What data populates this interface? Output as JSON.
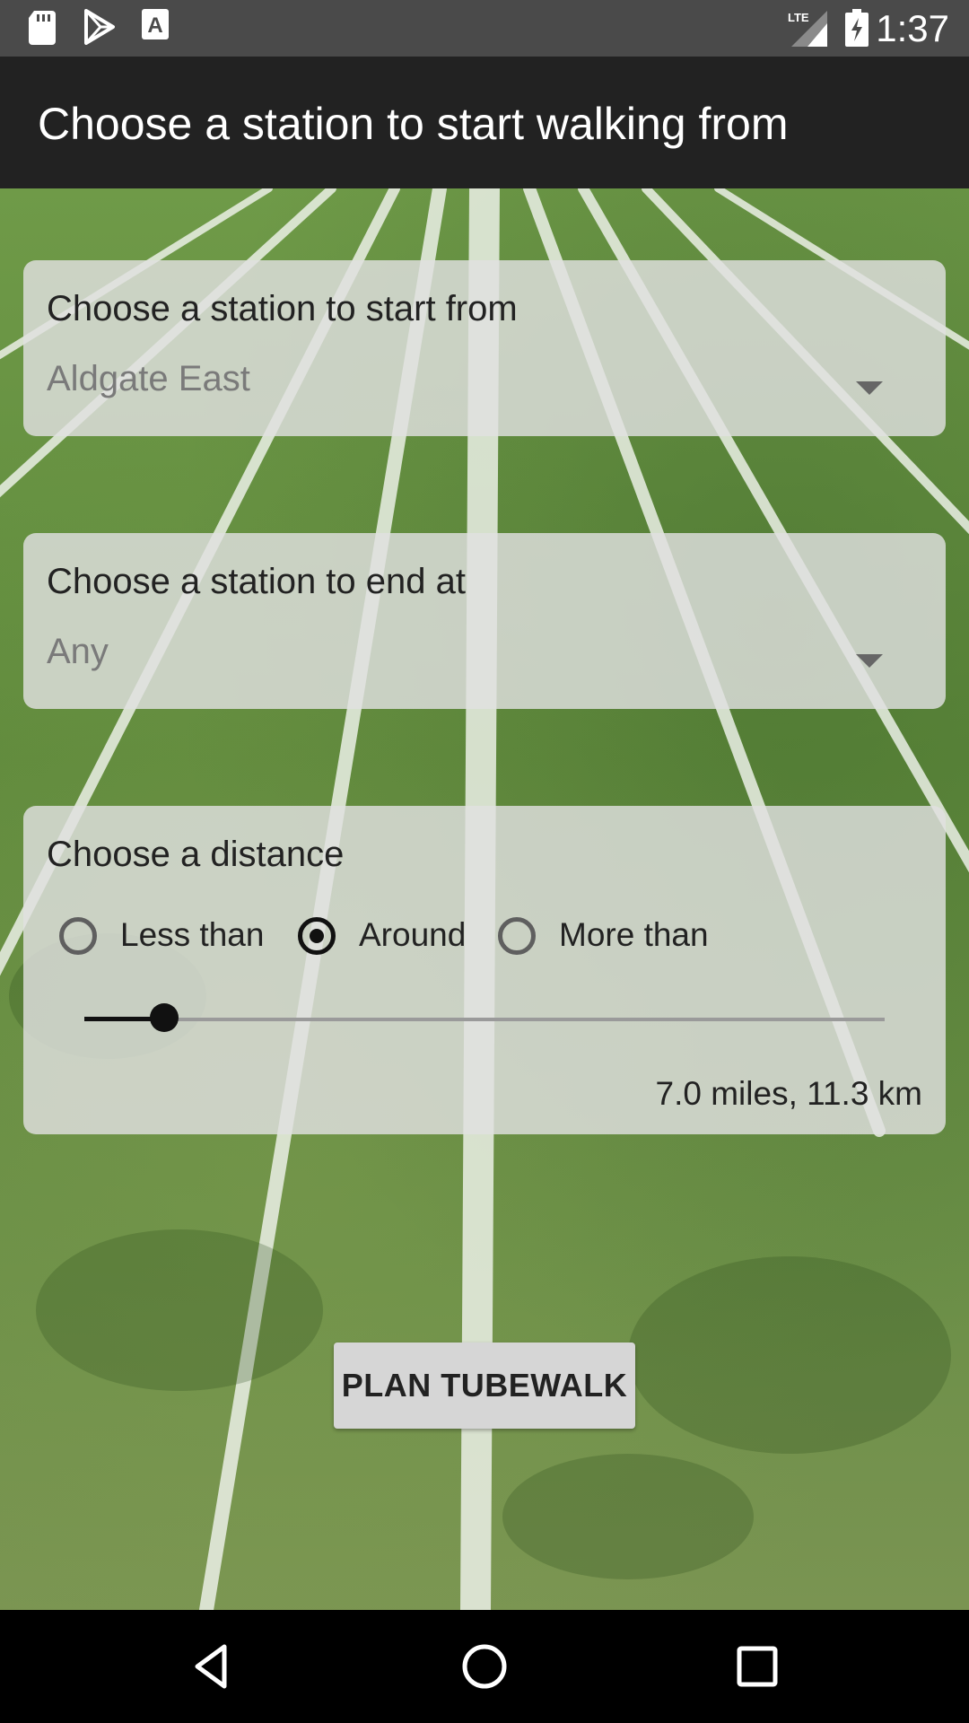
{
  "status_bar": {
    "time": "1:37",
    "network": "LTE",
    "icons": [
      "sd-card-icon",
      "play-store-icon",
      "a-font-icon",
      "signal-icon",
      "battery-charging-icon"
    ]
  },
  "app_bar": {
    "title": "Choose a station to start walking from"
  },
  "start_station": {
    "label": "Choose a station to start from",
    "value": "Aldgate East"
  },
  "end_station": {
    "label": "Choose a station to end at",
    "value": "Any"
  },
  "distance": {
    "label": "Choose a distance",
    "options": [
      {
        "label": "Less than",
        "checked": false
      },
      {
        "label": "Around",
        "checked": true
      },
      {
        "label": "More than",
        "checked": false
      }
    ],
    "slider_fraction": 0.1,
    "readout": "7.0 miles, 11.3 km"
  },
  "plan_button": {
    "label": "PLAN TUBEWALK"
  },
  "nav_bar": {
    "icons": [
      "back-icon",
      "home-icon",
      "recents-icon"
    ]
  },
  "colors": {
    "app_bar": "#222222",
    "status_bar": "#4a4a4a",
    "card": "#e1e1e1",
    "grass": "#6f9a48"
  }
}
